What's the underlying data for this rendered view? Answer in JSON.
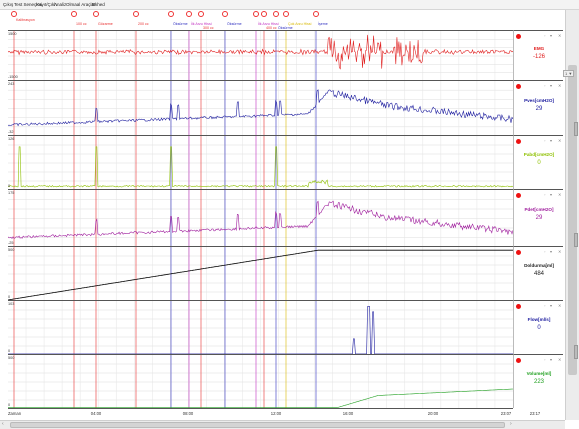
{
  "menu": [
    "Çıkış",
    "Test Seneçleri",
    "Kayıt/Çıkh",
    "Analiz",
    "Olmaal Araçlar",
    "Ekhed"
  ],
  "events": [
    {
      "label": "Kalibrasyon",
      "color": "#e83030"
    },
    {
      "label": "100 cc",
      "color": "#e83030"
    },
    {
      "label": "Gözarme",
      "color": "#e83030"
    },
    {
      "label": "200 cc",
      "color": "#e83030"
    },
    {
      "label": "Öksürme",
      "color": "#3030c0"
    },
    {
      "label": "İlk Arzu Hissi",
      "color": "#c030c0"
    },
    {
      "label": "300 cc",
      "color": "#e83030"
    },
    {
      "label": "Öksürme",
      "color": "#3030c0"
    },
    {
      "label": "İlk Arzu Hissi",
      "color": "#c030c0"
    },
    {
      "label": "400 cc",
      "color": "#e83030"
    },
    {
      "label": "Öksürme",
      "color": "#3030c0"
    },
    {
      "label": "Çok Arzu Hissi",
      "color": "#d8b800"
    },
    {
      "label": "İşeme",
      "color": "#3030c0"
    }
  ],
  "channels": [
    {
      "key": "emg",
      "title": "EMG",
      "value": "-126",
      "color": "#e02020",
      "ymax": "1500",
      "ymin": "-1500"
    },
    {
      "key": "pves",
      "title": "Pves[cmH2O]",
      "value": "29",
      "color": "#2020a0",
      "ymax": "243",
      "ymin": "-32"
    },
    {
      "key": "pabd",
      "title": "Pabd[cmH2O]",
      "value": "0",
      "color": "#8ec000",
      "ymax": "126",
      "ymin": "0"
    },
    {
      "key": "pdet",
      "title": "Pdet[cmH2O]",
      "value": "29",
      "color": "#a0209e",
      "ymax": "175",
      "ymin": "-25"
    },
    {
      "key": "doldurma",
      "title": "Doldurma[ml]",
      "value": "484",
      "color": "#000000",
      "ymax": "500",
      "ymin": "0"
    },
    {
      "key": "flow",
      "title": "Flow[ml/s]",
      "value": "0",
      "color": "#2020a0",
      "ymax": "103",
      "ymin": "0"
    },
    {
      "key": "volume",
      "title": "Volume[ml]",
      "value": "223",
      "color": "#20a020",
      "ymax": "500",
      "ymin": "0"
    }
  ],
  "emg_scale": "1 ▼",
  "xaxis": {
    "start": "Zaman",
    "ticks": [
      "04:00",
      "08:00",
      "12:00",
      "16:00",
      "20:00",
      "23:07"
    ],
    "end_value": "23:17"
  },
  "icons": {
    "dot": "record-dot",
    "lock": "lock-icon",
    "settings": "settings-icon",
    "close": "close-icon"
  },
  "sidebar_controls": {
    "settings": "◦",
    "dropdown": "▾",
    "close": "✕"
  }
}
